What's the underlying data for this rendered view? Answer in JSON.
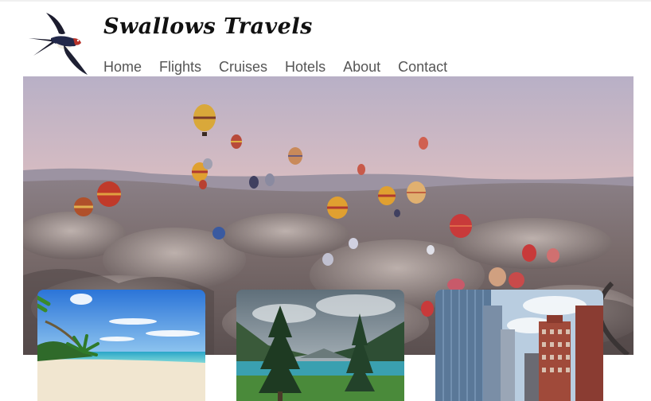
{
  "site": {
    "title": "Swallows Travels"
  },
  "nav": {
    "items": [
      {
        "label": "Home"
      },
      {
        "label": "Flights"
      },
      {
        "label": "Cruises"
      },
      {
        "label": "Hotels"
      },
      {
        "label": "About"
      },
      {
        "label": "Contact"
      }
    ]
  },
  "hero": {
    "image": "hot-air-balloons-over-valley"
  },
  "cards": [
    {
      "image": "tropical-beach"
    },
    {
      "image": "mountain-lake-forest"
    },
    {
      "image": "city-skyscrapers"
    }
  ],
  "colors": {
    "nav_text": "#555555",
    "title_text": "#111111"
  }
}
